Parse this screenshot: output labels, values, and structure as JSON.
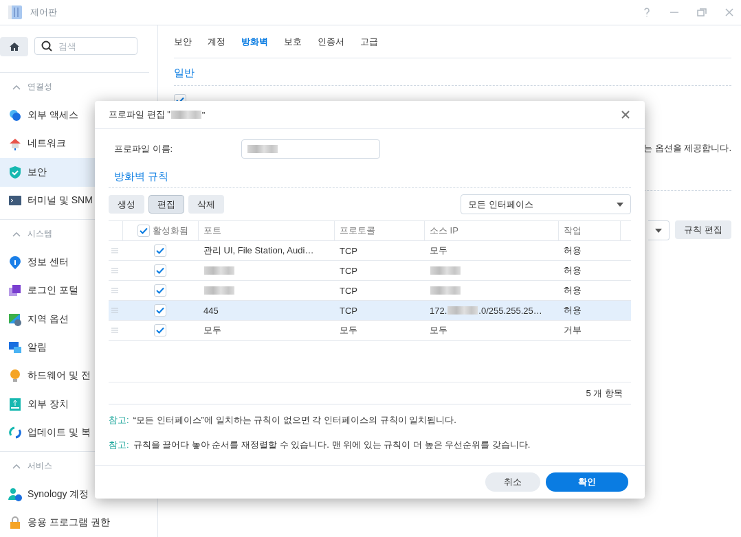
{
  "window": {
    "title": "제어판"
  },
  "sidebar": {
    "search": {
      "placeholder": "검색"
    },
    "groups": [
      {
        "label": "연결성",
        "expanded": true,
        "items": [
          {
            "label": "외부 액세스",
            "selected": false
          },
          {
            "label": "네트워크",
            "selected": false
          },
          {
            "label": "보안",
            "selected": true
          },
          {
            "label": "터미널 및 SNM",
            "selected": false
          }
        ]
      },
      {
        "label": "시스템",
        "expanded": true,
        "items": [
          {
            "label": "정보 센터",
            "selected": false
          },
          {
            "label": "로그인 포털",
            "selected": false
          },
          {
            "label": "지역 옵션",
            "selected": false
          },
          {
            "label": "알림",
            "selected": false
          },
          {
            "label": "하드웨어 및 전",
            "selected": false
          },
          {
            "label": "외부 장치",
            "selected": false
          },
          {
            "label": "업데이트 및 복",
            "selected": false
          }
        ]
      },
      {
        "label": "서비스",
        "expanded": true,
        "items": [
          {
            "label": "Synology 계정",
            "selected": false
          },
          {
            "label": "응용 프로그램 권한",
            "selected": false
          }
        ]
      }
    ]
  },
  "tabs": [
    {
      "label": "보안",
      "selected": false
    },
    {
      "label": "계정",
      "selected": false
    },
    {
      "label": "방화벽",
      "selected": true
    },
    {
      "label": "보호",
      "selected": false
    },
    {
      "label": "인증서",
      "selected": false
    },
    {
      "label": "고급",
      "selected": false
    }
  ],
  "main": {
    "section": "일반",
    "enable_checkbox": {
      "checked": true
    },
    "description": "는 옵션을 제공합니다.",
    "rule_edit_button": "규칙 편집"
  },
  "dialog": {
    "title": [
      {
        "kind": "text",
        "text": "프로파일 편집 \""
      },
      {
        "kind": "blur"
      },
      {
        "kind": "text",
        "text": "\""
      }
    ],
    "profile_name": {
      "label": "프로파일 이름:",
      "value": [
        {
          "kind": "blur"
        }
      ]
    },
    "section": "방화벽 규칙",
    "toolbar": [
      {
        "label": "생성",
        "pressed": false
      },
      {
        "label": "편집",
        "pressed": true
      },
      {
        "label": "삭제",
        "pressed": false
      }
    ],
    "interface_select": "모든 인터페이스",
    "header": {
      "enabled_label": "활성화됨",
      "checked": true,
      "columns": [
        "포트",
        "프로토콜",
        "소스 IP",
        "작업"
      ]
    },
    "rows": [
      {
        "selected": false,
        "enabled": true,
        "port": [
          {
            "kind": "text",
            "text": "관리 UI, File Station, Audi…"
          }
        ],
        "protocol": "TCP",
        "source_ip": [
          {
            "kind": "text",
            "text": "모두"
          }
        ],
        "action": "허용"
      },
      {
        "selected": false,
        "enabled": true,
        "port": [
          {
            "kind": "blur"
          }
        ],
        "protocol": "TCP",
        "source_ip": [
          {
            "kind": "blur"
          }
        ],
        "action": "허용"
      },
      {
        "selected": false,
        "enabled": true,
        "port": [
          {
            "kind": "blur"
          }
        ],
        "protocol": "TCP",
        "source_ip": [
          {
            "kind": "blur"
          }
        ],
        "action": "허용"
      },
      {
        "selected": true,
        "enabled": true,
        "port": [
          {
            "kind": "text",
            "text": "445"
          }
        ],
        "protocol": "TCP",
        "source_ip": [
          {
            "kind": "text",
            "text": "172."
          },
          {
            "kind": "blur"
          },
          {
            "kind": "text",
            "text": ".0/255.255.25…"
          }
        ],
        "action": "허용"
      },
      {
        "selected": false,
        "enabled": true,
        "port": [
          {
            "kind": "text",
            "text": "모두"
          }
        ],
        "protocol": "모두",
        "source_ip": [
          {
            "kind": "text",
            "text": "모두"
          }
        ],
        "action": "거부"
      }
    ],
    "count": "5 개 항목",
    "notes": [
      {
        "label": "참고:",
        "text": "“모든 인터페이스”에 일치하는 규칙이 없으면 각 인터페이스의 규칙이 일치됩니다."
      },
      {
        "label": "참고:",
        "text": "규칙을 끌어다 놓아 순서를 재정렬할 수 있습니다. 맨 위에 있는 규칙이 더 높은 우선순위를 갖습니다."
      }
    ],
    "buttons": [
      {
        "label": "취소",
        "kind": "secondary"
      },
      {
        "label": "확인",
        "kind": "primary"
      }
    ]
  }
}
